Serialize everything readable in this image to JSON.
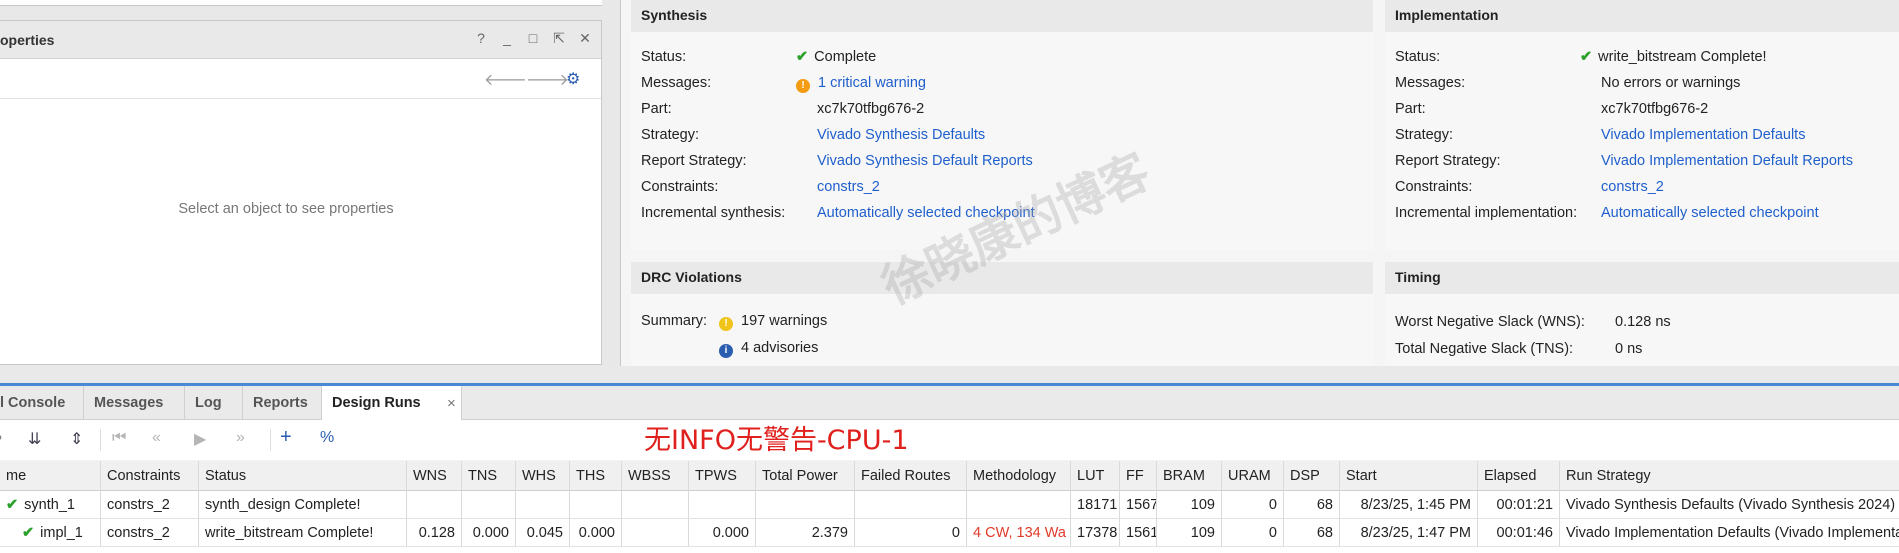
{
  "properties": {
    "title": "operties",
    "empty_text": "Select an object to see properties",
    "controls": [
      "?",
      "_",
      "□",
      "⇱",
      "✕"
    ]
  },
  "synthesis": {
    "heading": "Synthesis",
    "rows": [
      {
        "key": "Status:",
        "value": "Complete"
      },
      {
        "key": "Messages:",
        "value": "1 critical warning"
      },
      {
        "key": "Part:",
        "value": "xc7k70tfbg676-2"
      },
      {
        "key": "Strategy:",
        "value": "Vivado Synthesis Defaults"
      },
      {
        "key": "Report Strategy:",
        "value": "Vivado Synthesis Default Reports"
      },
      {
        "key": "Constraints:",
        "value": "constrs_2"
      },
      {
        "key": "Incremental synthesis:",
        "value": "Automatically selected checkpoint"
      }
    ]
  },
  "implementation": {
    "heading": "Implementation",
    "rows": [
      {
        "key": "Status:",
        "value": "write_bitstream Complete!"
      },
      {
        "key": "Messages:",
        "value": "No errors or warnings"
      },
      {
        "key": "Part:",
        "value": "xc7k70tfbg676-2"
      },
      {
        "key": "Strategy:",
        "value": "Vivado Implementation Defaults"
      },
      {
        "key": "Report Strategy:",
        "value": "Vivado Implementation Default Reports"
      },
      {
        "key": "Constraints:",
        "value": "constrs_2"
      },
      {
        "key": "Incremental implementation:",
        "value": "Automatically selected checkpoint"
      }
    ]
  },
  "drc": {
    "heading": "DRC Violations",
    "summary_key": "Summary:",
    "warnings": "197 warnings",
    "advisories": "4 advisories"
  },
  "timing": {
    "heading": "Timing",
    "rows": [
      {
        "key": "Worst Negative Slack (WNS):",
        "value": "0.128 ns"
      },
      {
        "key": "Total Negative Slack (TNS):",
        "value": "0 ns"
      }
    ]
  },
  "tabs": [
    "l Console",
    "Messages",
    "Log",
    "Reports",
    "Design Runs"
  ],
  "tab_close": "×",
  "annotation": "无INFO无警告-CPU-1",
  "watermark": "徐晓康的博客",
  "table": {
    "columns": [
      "me",
      "Constraints",
      "Status",
      "WNS",
      "TNS",
      "WHS",
      "THS",
      "WBSS",
      "TPWS",
      "Total Power",
      "Failed Routes",
      "Methodology",
      "LUT",
      "FF",
      "BRAM",
      "URAM",
      "DSP",
      "Start",
      "Elapsed",
      "Run Strategy"
    ],
    "rows": [
      [
        "synth_1",
        "constrs_2",
        "synth_design Complete!",
        "",
        "",
        "",
        "",
        "",
        "",
        "",
        "",
        "",
        "18171",
        "1567",
        "109",
        "0",
        "68",
        "8/23/25, 1:45 PM",
        "00:01:21",
        "Vivado Synthesis Defaults (Vivado Synthesis 2024)"
      ],
      [
        "impl_1",
        "constrs_2",
        "write_bitstream Complete!",
        "0.128",
        "0.000",
        "0.045",
        "0.000",
        "",
        "0.000",
        "2.379",
        "0",
        "4 CW, 134 Wa",
        "17378",
        "1561",
        "109",
        "0",
        "68",
        "8/23/25, 1:47 PM",
        "00:01:46",
        "Vivado Implementation Defaults (Vivado Implementa"
      ]
    ]
  },
  "colors": {
    "link": "#1f5fcc",
    "check": "#2ca02c",
    "annotation": "#e0201c",
    "accent_line": "#4a8ad4"
  }
}
